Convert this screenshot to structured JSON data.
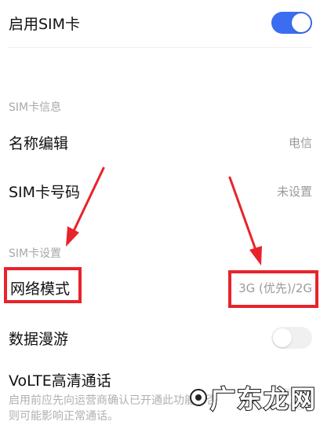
{
  "enable_sim": {
    "label": "启用SIM卡",
    "state": "on"
  },
  "sim_info": {
    "header": "SIM卡信息",
    "name_edit": {
      "label": "名称编辑",
      "value": "电信"
    },
    "sim_number": {
      "label": "SIM卡号码",
      "value": "未设置"
    }
  },
  "sim_settings": {
    "header": "SIM卡设置",
    "network_mode": {
      "label": "网络模式",
      "value": "3G (优先)/2G"
    },
    "data_roaming": {
      "label": "数据漫游",
      "state": "off"
    },
    "volte": {
      "label": "VoLTE高清通话",
      "description": "启用前应先向运营商确认已开通此功能，否则可能影响正常通话。",
      "state": "off"
    }
  },
  "watermark": {
    "text": "广东龙网"
  },
  "colors": {
    "accent": "#3a6df0",
    "highlight": "#e8232b"
  }
}
